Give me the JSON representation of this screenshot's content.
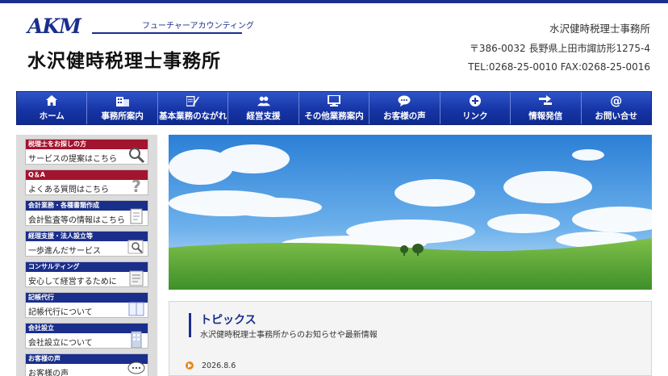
{
  "header": {
    "logo_mark": "AKM",
    "logo_kana": "フューチャーアカウンティング",
    "office_name": "水沢健時税理士事務所",
    "info_name": "水沢健時税理士事務所",
    "address": "〒386-0032 長野県上田市諏訪形1275-4",
    "tel": "TEL:0268-25-0010 FAX:0268-25-0016"
  },
  "nav": [
    {
      "label": "ホーム",
      "icon": "home-icon"
    },
    {
      "label": "事務所案内",
      "icon": "building-icon"
    },
    {
      "label": "基本業務のながれ",
      "icon": "edit-icon"
    },
    {
      "label": "経営支援",
      "icon": "users-icon"
    },
    {
      "label": "その他業務案内",
      "icon": "monitor-icon"
    },
    {
      "label": "お客様の声",
      "icon": "chat-icon"
    },
    {
      "label": "リンク",
      "icon": "plus-circle-icon"
    },
    {
      "label": "情報発信",
      "icon": "share-icon"
    },
    {
      "label": "お問い合せ",
      "icon": "at-icon"
    }
  ],
  "sidebar": [
    {
      "head": "税理士をお探しの方",
      "text": "サービスの提案はこちら",
      "color": "red",
      "icon": "magnifier-icon"
    },
    {
      "head": "Q＆A",
      "text": "よくある質問はこちら",
      "color": "red",
      "icon": "question-icon"
    },
    {
      "head": "会計業務・各種書類作成",
      "text": "会計監査等の情報はこちら",
      "color": "blue",
      "icon": "document-icon"
    },
    {
      "head": "経理支援・法人設立等",
      "text": "一歩進んだサービス",
      "color": "blue",
      "icon": "magnifier-icon"
    },
    {
      "head": "コンサルティング",
      "text": "安心して経営するために",
      "color": "blue",
      "icon": "clipboard-icon"
    },
    {
      "head": "記帳代行",
      "text": "記帳代行について",
      "color": "blue",
      "icon": "ledger-icon"
    },
    {
      "head": "会社設立",
      "text": "会社設立について",
      "color": "blue",
      "icon": "office-building-icon"
    },
    {
      "head": "お客様の声",
      "text": "お客様の声",
      "color": "blue",
      "icon": "speech-bubble-icon"
    }
  ],
  "topics": {
    "title": "トピックス",
    "subtitle": "水沢健時税理士事務所からのお知らせや最新情報",
    "items": [
      {
        "date": "2026.8.6"
      }
    ]
  },
  "colors": {
    "brand": "#1a2e8c",
    "accent_red": "#a3142e",
    "bullet": "#e8891a"
  }
}
